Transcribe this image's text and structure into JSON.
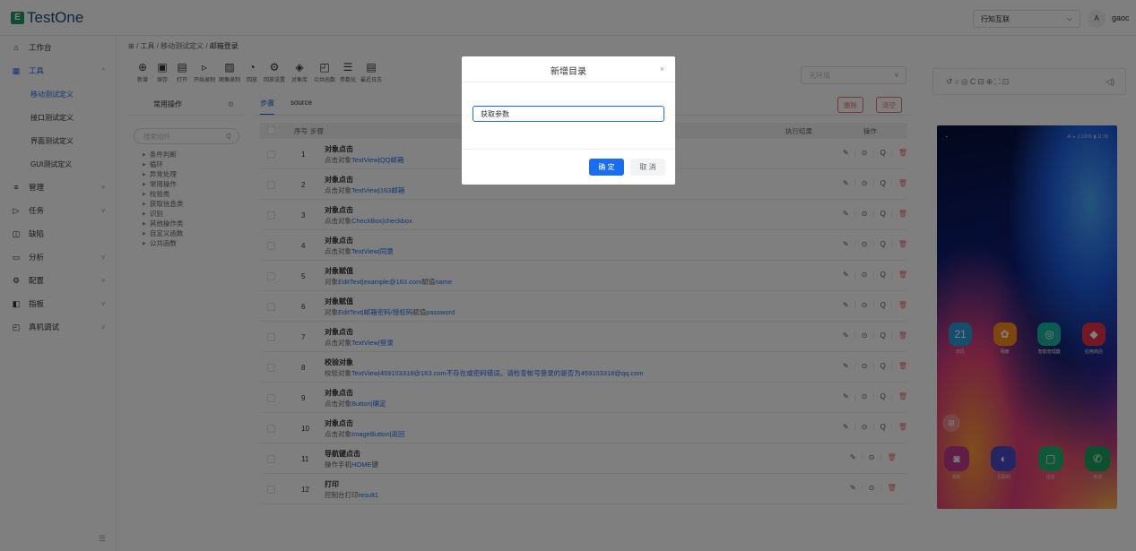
{
  "app": {
    "logo": "TestOne",
    "logo_mark": "E"
  },
  "header": {
    "project": "行知互联",
    "lang": "A",
    "user": "gaoc"
  },
  "sidebar": {
    "items": [
      {
        "icon": "⌂",
        "label": "工作台"
      },
      {
        "icon": "▦",
        "label": "工具",
        "chev": "^"
      },
      {
        "icon": "≡",
        "label": "管理",
        "chev": "v"
      },
      {
        "icon": "▷",
        "label": "任务",
        "chev": "v"
      },
      {
        "icon": "◫",
        "label": "缺陷"
      },
      {
        "icon": "▭",
        "label": "分析",
        "chev": "v"
      },
      {
        "icon": "⚙",
        "label": "配置",
        "chev": "v"
      },
      {
        "icon": "◧",
        "label": "指板",
        "chev": "v"
      },
      {
        "icon": "◰",
        "label": "真机调试",
        "chev": "v"
      }
    ],
    "sub": [
      "移动测试定义",
      "接口测试定义",
      "界面测试定义",
      "GUI测试定义"
    ],
    "collapse": "☰"
  },
  "breadcrumb": {
    "home": "⊞",
    "sep": "/",
    "level1": "工具",
    "level2": "移动测试定义",
    "current": "邮箱登录"
  },
  "toolbar": [
    {
      "icon": "⊕",
      "label": "新增"
    },
    {
      "icon": "▣",
      "label": "保存"
    },
    {
      "icon": "▤",
      "label": "打开"
    },
    {
      "icon": "▹",
      "label": "开始录制"
    },
    {
      "icon": "▨",
      "label": "图像录制"
    },
    {
      "icon": "◔",
      "label": "回放"
    },
    {
      "icon": "⚙",
      "label": "回放设置"
    },
    {
      "icon": "◈",
      "label": "对象库"
    },
    {
      "icon": "◰",
      "label": "公共函数"
    },
    {
      "icon": "☰",
      "label": "参数化"
    },
    {
      "icon": "▤",
      "label": "最近日志"
    }
  ],
  "env": {
    "placeholder": "无环境",
    "arrow": "v"
  },
  "left_panel": {
    "title": "常用操作",
    "search": "搜索组件",
    "tree": [
      "条件判断",
      "循环",
      "异常处理",
      "常用操作",
      "校验类",
      "获取信息类",
      "识别",
      "其他操作类",
      "自定义函数",
      "公共函数"
    ]
  },
  "tabs": [
    "步骤",
    "source"
  ],
  "actions": {
    "delete": "删除",
    "clear": "清空"
  },
  "table": {
    "headers": {
      "seq": "序号",
      "step": "步骤",
      "result": "执行结果",
      "op": "操作"
    },
    "rows": [
      {
        "seq": "1",
        "title": "对象点击",
        "prefix": "点击对象",
        "target": "TextView|QQ邮箱",
        "suffix": ""
      },
      {
        "seq": "2",
        "title": "对象点击",
        "prefix": "点击对象",
        "target": "TextView|163邮箱",
        "suffix": ""
      },
      {
        "seq": "3",
        "title": "对象点击",
        "prefix": "点击对象",
        "target": "CheckBox|checkbox",
        "suffix": ""
      },
      {
        "seq": "4",
        "title": "对象点击",
        "prefix": "点击对象",
        "target": "TextView|同意",
        "suffix": ""
      },
      {
        "seq": "5",
        "title": "对象赋值",
        "prefix": "对象",
        "target": "EditText|example@163.com",
        "suffix": "赋值",
        "extra": "name"
      },
      {
        "seq": "6",
        "title": "对象赋值",
        "prefix": "对象",
        "target": "EditText|邮箱密码/授权码",
        "suffix": "赋值",
        "extra": "password"
      },
      {
        "seq": "7",
        "title": "对象点击",
        "prefix": "点击对象",
        "target": "TextView|登录",
        "suffix": ""
      },
      {
        "seq": "8",
        "title": "校验对象",
        "prefix": "校验对象",
        "target": "TextView|459103318@163.com不存在或密码错误。请检查帐号登录的是否为459103318@qq.com",
        "suffix": ""
      },
      {
        "seq": "9",
        "title": "对象点击",
        "prefix": "点击对象",
        "target": "Button|确定",
        "suffix": ""
      },
      {
        "seq": "10",
        "title": "对象点击",
        "prefix": "点击对象",
        "target": "ImageButton|返回",
        "suffix": ""
      },
      {
        "seq": "11",
        "title": "导航键点击",
        "prefix": "操作手机",
        "target": "HOME",
        "suffix": "键",
        "short": true
      },
      {
        "seq": "12",
        "title": "打印",
        "prefix": "控制台打印",
        "target": "result1",
        "suffix": "",
        "short": true
      }
    ],
    "op_icons": {
      "edit": "✎",
      "run": "⊙",
      "find": "Q",
      "delete": "🗑"
    }
  },
  "device": {
    "toolbar_icons": "↺○◎C⊟⊕⛶⊡",
    "volume": "◁)",
    "status_left": "▪",
    "status_right": "⁂ ◂ .ıl 100% ▮ 11:08",
    "apps": [
      {
        "label": "日历",
        "icon": "21",
        "color": "#2a9ad8"
      },
      {
        "label": "相册",
        "icon": "✿",
        "color": "#ff8a20"
      },
      {
        "label": "智能管理器",
        "icon": "◎",
        "color": "#18b4a0"
      },
      {
        "label": "应用商店",
        "icon": "◆",
        "color": "#e8304a"
      }
    ],
    "dock": [
      {
        "label": "相机",
        "icon": "◙",
        "color": "#c23a8a"
      },
      {
        "label": "互联网",
        "icon": "◐",
        "color": "#4a4ac8"
      },
      {
        "label": "信息",
        "icon": "▢",
        "color": "#23b070"
      },
      {
        "label": "电话",
        "icon": "✆",
        "color": "#1aa060"
      }
    ],
    "folder": "⊞"
  },
  "dialog": {
    "title": "新增目录",
    "close": "×",
    "value": "获取参数",
    "ok": "确 定",
    "cancel": "取 消"
  }
}
